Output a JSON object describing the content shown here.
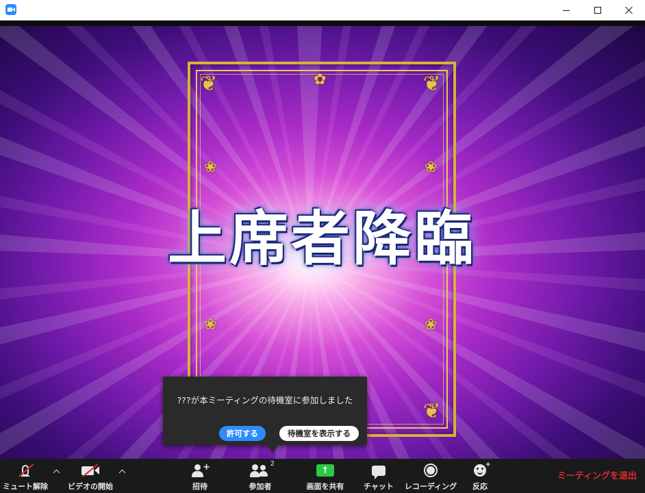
{
  "window": {
    "app_icon": "zoom-video-icon",
    "controls": {
      "minimize": "minimize-icon",
      "maximize": "maximize-icon",
      "close": "close-icon"
    }
  },
  "video": {
    "headline": "上席者降臨"
  },
  "notification": {
    "message": "???が本ミーティングの待機室に参加しました",
    "admit_label": "許可する",
    "view_waiting_room_label": "待機室を表示する"
  },
  "toolbar": {
    "unmute_label": "ミュート解除",
    "start_video_label": "ビデオの開始",
    "invite_label": "招待",
    "participants_label": "参加者",
    "participants_count": "2",
    "share_screen_label": "画面を共有",
    "chat_label": "チャット",
    "recording_label": "レコーディング",
    "reactions_label": "反応",
    "leave_label": "ミーティングを退出",
    "accent_share": "#2bc846",
    "accent_leave": "#e02b2b",
    "accent_primary": "#2d8cff"
  }
}
